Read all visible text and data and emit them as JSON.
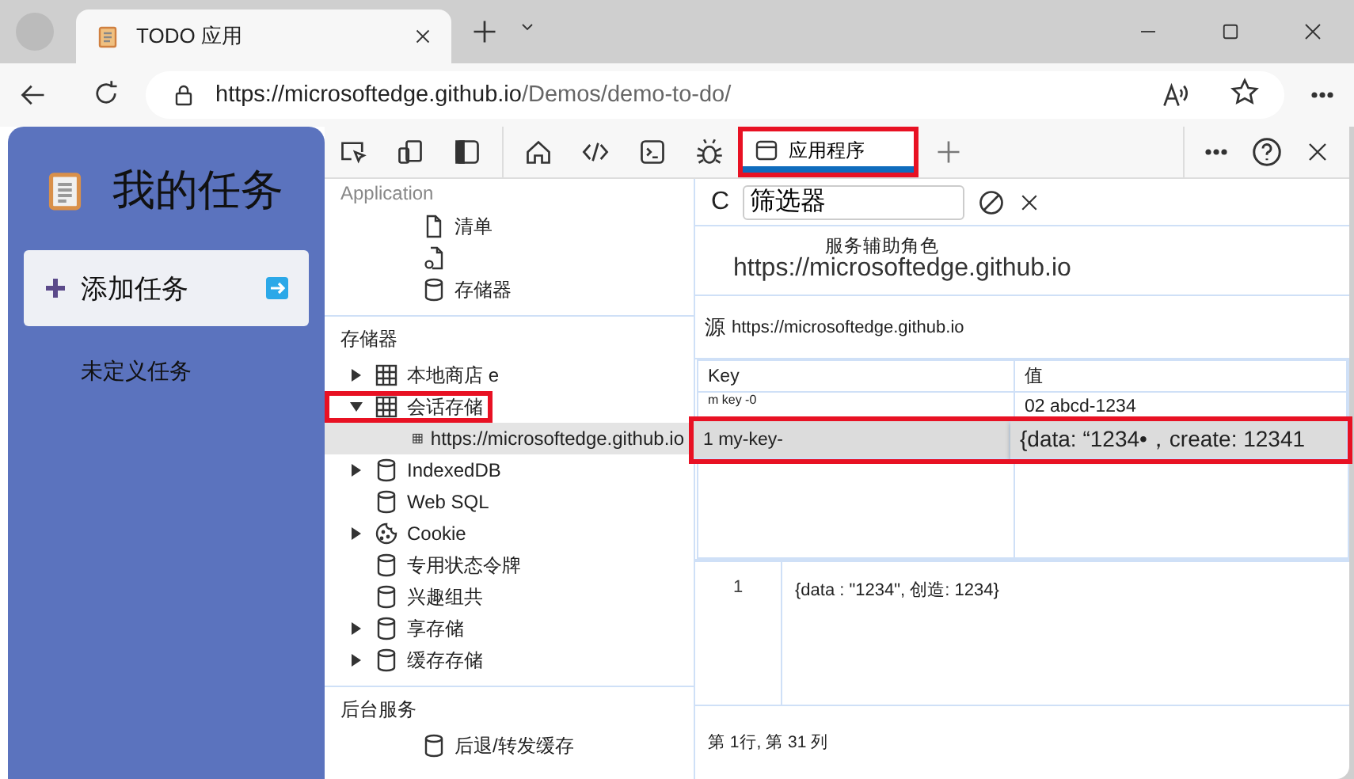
{
  "browser": {
    "tab_title": "TODO 应用",
    "url_host": "https://microsoftedge.github.io",
    "url_path": "/Demos/demo-to-do/"
  },
  "app": {
    "title": "我的任务",
    "add_button": "添加任务",
    "empty_text": "未定义任务"
  },
  "devtools": {
    "tools": [
      {
        "kind": "inspect"
      },
      {
        "kind": "device"
      },
      {
        "kind": "dock"
      },
      {
        "kind": "home"
      },
      {
        "kind": "code"
      },
      {
        "kind": "console"
      },
      {
        "kind": "bug"
      }
    ],
    "tab": {
      "label": "应用程序",
      "selected": true,
      "highlighted": true
    },
    "sidebar": {
      "sections": [
        {
          "title": "Application",
          "items": [
            {
              "kind": "doc",
              "label": "清单"
            },
            {
              "kind": "gear-doc"
            },
            {
              "kind": "db",
              "label": "存储器"
            }
          ]
        },
        {
          "title": "存储器",
          "items": [
            {
              "kind": "grid",
              "label": "本地商店 e",
              "expanded": false
            },
            {
              "kind": "grid",
              "label": "会话存储",
              "expanded": true,
              "highlighted": true,
              "children": [
                {
                  "kind": "grid",
                  "label": "https://microsoftedge.github.io",
                  "selected": true
                }
              ]
            },
            {
              "kind": "db",
              "label": "IndexedDB",
              "expanded": false
            },
            {
              "kind": "db",
              "label": "Web SQL"
            },
            {
              "kind": "cookie",
              "label": "Cookie",
              "expanded": false
            },
            {
              "kind": "db",
              "label": "专用状态令牌"
            },
            {
              "kind": "db",
              "label": "兴趣组共"
            },
            {
              "kind": "db",
              "label": "享存储",
              "expanded": false
            },
            {
              "kind": "db",
              "label": "缓存存储",
              "expanded": false
            }
          ]
        },
        {
          "title": "后台服务",
          "items": [
            {
              "kind": "db",
              "label": "后退/转发缓存"
            }
          ]
        }
      ]
    },
    "main": {
      "refresh_label": "C",
      "filter": {
        "value": "筛选器"
      },
      "service_worker": {
        "label": "服务辅助角色",
        "url": "https://microsoftedge.github.io"
      },
      "origin": {
        "label": "源",
        "value": "https://microsoftedge.github.io"
      },
      "table": {
        "columns": [
          "Key",
          "值"
        ],
        "rows": [
          {
            "key": "m key -0",
            "value": "02 abcd-1234",
            "selected": false,
            "highlighted": false
          },
          {
            "key": "1 my-key-",
            "value": "{data: “1234•，create: 12341",
            "selected": true,
            "highlighted": true
          }
        ]
      },
      "preview": {
        "line_number": "1",
        "code": "{data : \"1234\", 创造: 1234}"
      },
      "status": "第 1行, 第 31 列"
    }
  }
}
